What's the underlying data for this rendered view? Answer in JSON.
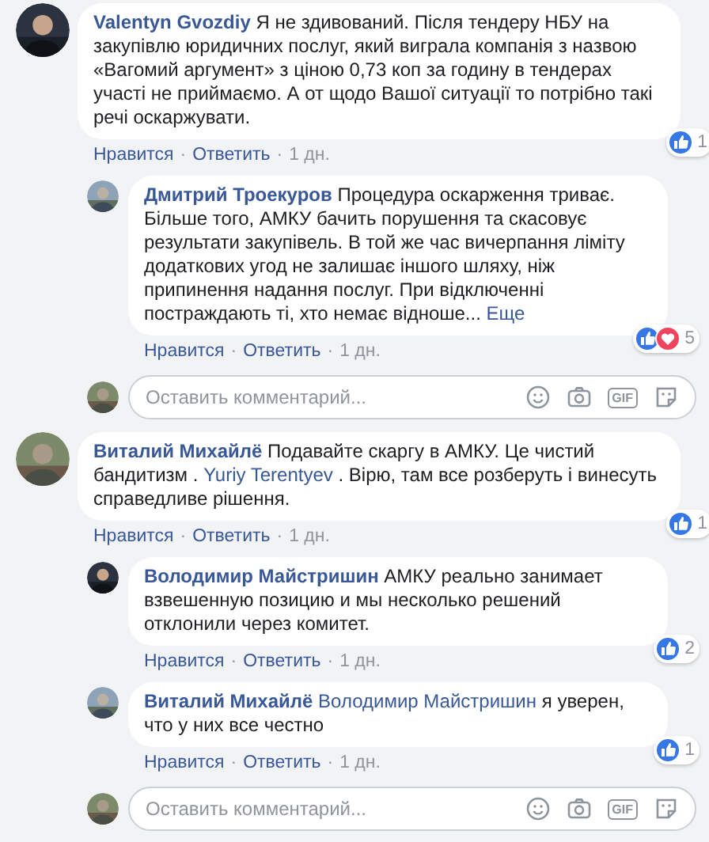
{
  "threads": [
    {
      "author": "Valentyn Gvozdiy",
      "body": [
        {
          "kind": "text",
          "text": "Я не здивований. Після тендеру НБУ на закупівлю юридичних послуг, який виграла компанія з назвою «Вагомий аргумент» з ціною 0,73 коп за годину в тендерах участі не приймаємо. А от щодо Вашої ситуації то потрібно такі речі оскаржувати."
        }
      ],
      "actions": [
        {
          "kind": "link",
          "text": "Нравится"
        },
        {
          "kind": "sep",
          "text": "·"
        },
        {
          "kind": "link",
          "text": "Ответить"
        },
        {
          "kind": "sep",
          "text": "·"
        },
        {
          "kind": "time",
          "text": "1 дн."
        }
      ],
      "reactions": [
        {
          "kind": "like"
        }
      ],
      "reaction_count": "1",
      "replies": [
        {
          "author": "Дмитрий Троекуров",
          "body": [
            {
              "kind": "text",
              "text": "Процедура оскарження триває. Більше того, АМКУ бачить порушення та скасовує результати закупівель. В той же час вичерпання ліміту додаткових угод не залишає іншого шляху, ніж припинення надання послуг. При відключенні постраждають ті, хто немає відноше..."
            },
            {
              "kind": "more",
              "text": "Еще"
            }
          ],
          "actions": [
            {
              "kind": "link",
              "text": "Нравится"
            },
            {
              "kind": "sep",
              "text": "·"
            },
            {
              "kind": "link",
              "text": "Ответить"
            },
            {
              "kind": "sep",
              "text": "·"
            },
            {
              "kind": "time",
              "text": "1 дн."
            }
          ],
          "reactions": [
            {
              "kind": "like"
            },
            {
              "kind": "love"
            }
          ],
          "reaction_count": "5"
        }
      ],
      "composer": {
        "placeholder": "Оставить комментарий...",
        "gif_label": "GIF"
      }
    },
    {
      "author": "Виталий Михайлё",
      "body": [
        {
          "kind": "text",
          "text": "Подавайте скаргу в АМКУ. Це чистий бандитизм ."
        },
        {
          "kind": "link",
          "text": "Yuriy Terentyev"
        },
        {
          "kind": "text",
          "text": ". Вірю, там все розберуть і винесуть справедливе рішення."
        }
      ],
      "actions": [
        {
          "kind": "link",
          "text": "Нравится"
        },
        {
          "kind": "sep",
          "text": "·"
        },
        {
          "kind": "link",
          "text": "Ответить"
        },
        {
          "kind": "sep",
          "text": "·"
        },
        {
          "kind": "time",
          "text": "1 дн."
        }
      ],
      "reactions": [
        {
          "kind": "like"
        }
      ],
      "reaction_count": "1",
      "replies": [
        {
          "author": "Володимир Майстришин",
          "body": [
            {
              "kind": "text",
              "text": "АМКУ реально занимает взвешенную позицию и мы несколько решений отклонили через комитет."
            }
          ],
          "actions": [
            {
              "kind": "link",
              "text": "Нравится"
            },
            {
              "kind": "sep",
              "text": "·"
            },
            {
              "kind": "link",
              "text": "Ответить"
            },
            {
              "kind": "sep",
              "text": "·"
            },
            {
              "kind": "time",
              "text": "1 дн."
            }
          ],
          "reactions": [
            {
              "kind": "like"
            }
          ],
          "reaction_count": "2"
        },
        {
          "author": "Виталий Михайлё",
          "body": [
            {
              "kind": "link",
              "text": "Володимир Майстришин"
            },
            {
              "kind": "text",
              "text": "я уверен, что у них все честно"
            }
          ],
          "actions": [
            {
              "kind": "link",
              "text": "Нравится"
            },
            {
              "kind": "sep",
              "text": "·"
            },
            {
              "kind": "link",
              "text": "Ответить"
            },
            {
              "kind": "sep",
              "text": "·"
            },
            {
              "kind": "time",
              "text": "1 дн."
            }
          ],
          "reactions": [
            {
              "kind": "like"
            }
          ],
          "reaction_count": "1"
        }
      ],
      "composer": {
        "placeholder": "Оставить комментарий...",
        "gif_label": "GIF"
      }
    }
  ]
}
